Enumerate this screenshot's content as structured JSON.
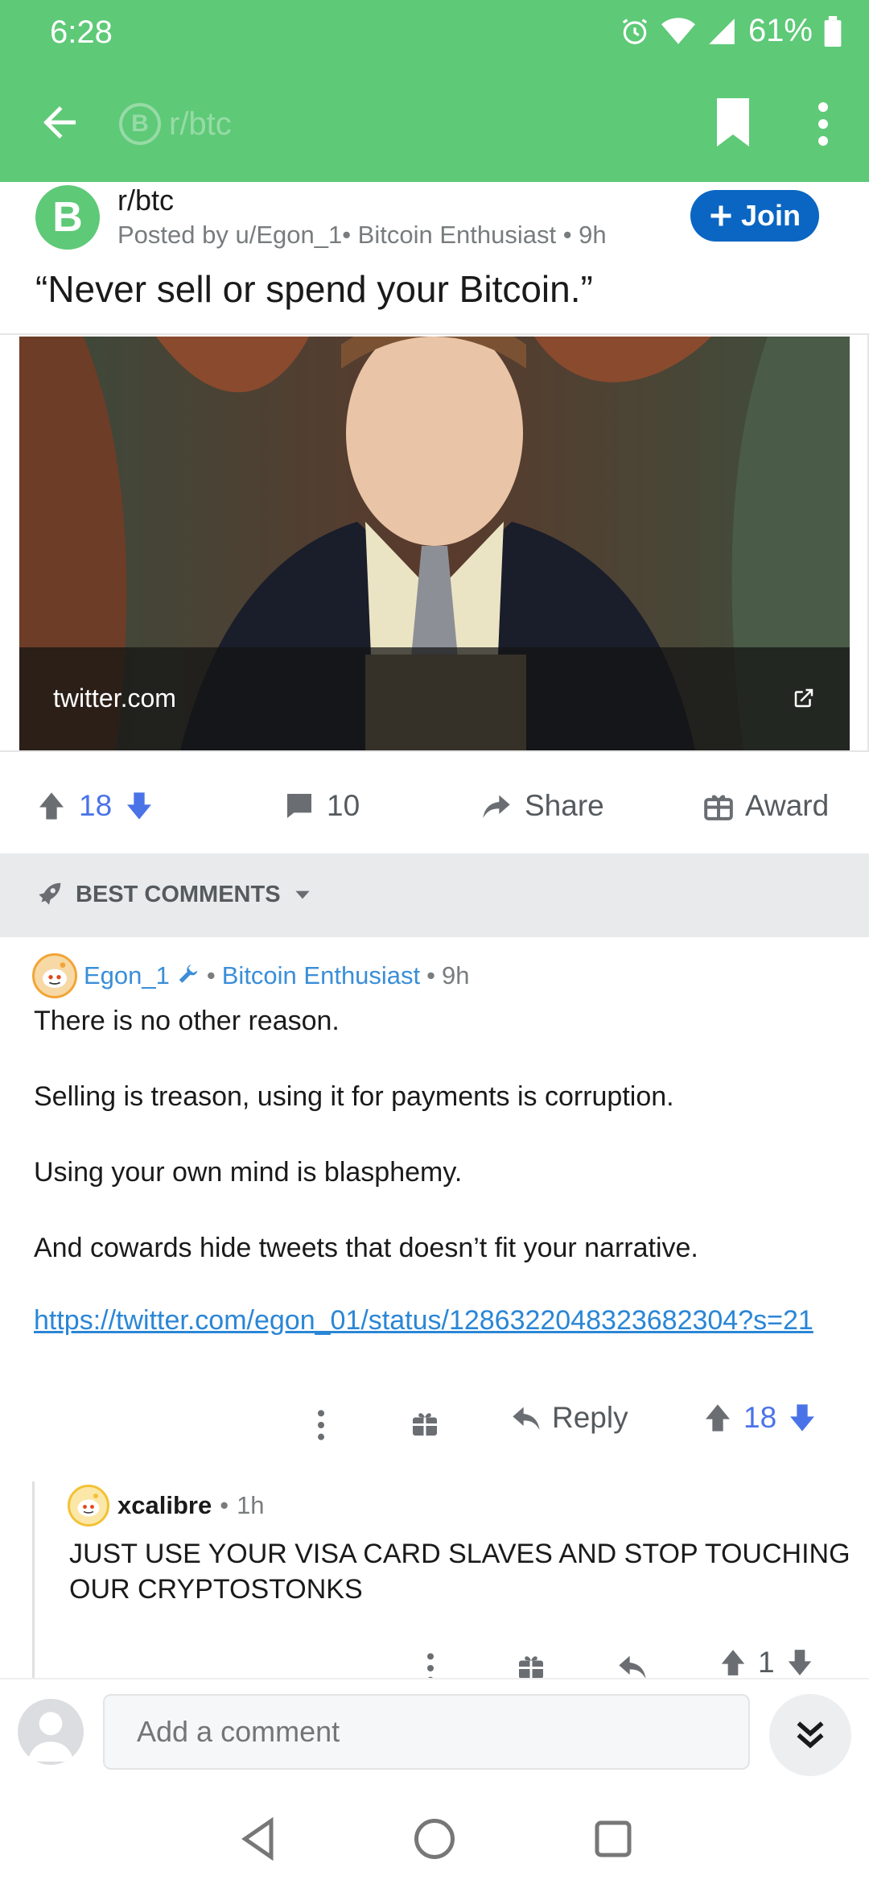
{
  "status_bar": {
    "time": "6:28",
    "battery": "61%"
  },
  "app_bar": {
    "subreddit": "r/btc",
    "subreddit_icon_letter": "B"
  },
  "post": {
    "subreddit": "r/btc",
    "avatar_letter": "B",
    "meta": "Posted by u/Egon_1• Bitcoin Enthusiast • 9h",
    "join_label": "Join",
    "title": "“Never sell or spend your Bitcoin.”",
    "link_domain": "twitter.com",
    "vote_count": "18",
    "comment_count": "10",
    "share_label": "Share",
    "award_label": "Award"
  },
  "sort": {
    "label": "BEST COMMENTS"
  },
  "comments": [
    {
      "author": "Egon_1",
      "flair": "Bitcoin Enthusiast",
      "time": "9h",
      "paragraphs": [
        "There is no other reason.",
        "Selling is treason, using it for payments is corruption.",
        "Using your own mind is blasphemy.",
        "And cowards hide tweets that doesn’t fit your narrative."
      ],
      "link": "https://twitter.com/egon_01/status/1286322048323682304?s=21",
      "reply_label": "Reply",
      "vote_count": "18"
    },
    {
      "author": "xcalibre",
      "time": "1h",
      "body": "JUST USE YOUR VISA CARD SLAVES AND STOP TOUCHING OUR CRYPTOSTONKS",
      "vote_count": "1"
    }
  ],
  "composer": {
    "placeholder": "Add a comment"
  },
  "colors": {
    "brand_green": "#5ec977",
    "join_blue": "#0a66c2",
    "link_blue": "#2a86d6",
    "vote_blue": "#4a73e8"
  }
}
